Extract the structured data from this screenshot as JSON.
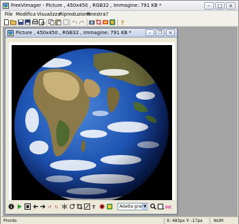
{
  "app": {
    "title": "FreeVimager - Picture , 450x450 , RGB32 , Immagine: 791 KB *"
  },
  "menu": {
    "items": [
      {
        "label": "File"
      },
      {
        "label": "Modifica"
      },
      {
        "label": "Visualizza"
      },
      {
        "label": "Riproduzione"
      },
      {
        "label": "Finestra"
      },
      {
        "label": "?"
      }
    ]
  },
  "toolbar": {
    "icons": [
      "new-icon",
      "open-icon",
      "save-icon",
      "save-as-icon",
      "print-icon",
      "copy-icon",
      "paste-icon",
      "undo-icon",
      "redo-icon",
      "capture-icon",
      "crop-icon",
      "email-icon",
      "about-icon"
    ]
  },
  "child": {
    "title": "Picture , 450x450 , RGB32 , Immagine: 791 KB *"
  },
  "navbar": {
    "zoom_value": "Adatta grandi."
  },
  "status": {
    "text": "Pronto",
    "coords": "X: 483px  Y: -17px",
    "num": "NUM"
  },
  "colors": {
    "accent": "#2f6fd6",
    "title_bg": "#e8e8ec",
    "child_title_bg": "#cdd7ec"
  }
}
